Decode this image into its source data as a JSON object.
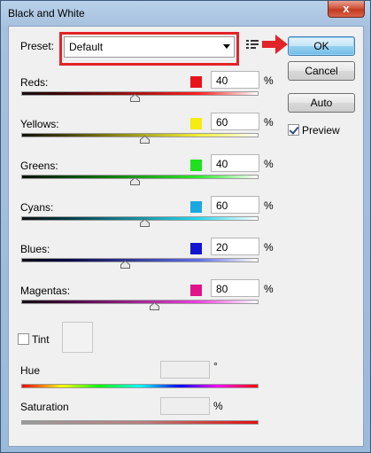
{
  "window": {
    "title": "Black and White",
    "close_glyph": "x"
  },
  "preset": {
    "label": "Preset:",
    "value": "Default"
  },
  "buttons": {
    "ok": "OK",
    "cancel": "Cancel",
    "auto": "Auto"
  },
  "preview": {
    "label": "Preview",
    "checked": true
  },
  "sliders": [
    {
      "name": "reds",
      "label": "Reds:",
      "value": "40",
      "unit": "%",
      "swatch": "#e8141c",
      "track_from": "#3a0000",
      "track_to": "#ff2020",
      "level": 0.48
    },
    {
      "name": "yellows",
      "label": "Yellows:",
      "value": "60",
      "unit": "%",
      "swatch": "#f5ec10",
      "track_from": "#3a3600",
      "track_to": "#f5ef35",
      "level": 0.52
    },
    {
      "name": "greens",
      "label": "Greens:",
      "value": "40",
      "unit": "%",
      "swatch": "#1fe01c",
      "track_from": "#003a00",
      "track_to": "#2fe82c",
      "level": 0.48
    },
    {
      "name": "cyans",
      "label": "Cyans:",
      "value": "60",
      "unit": "%",
      "swatch": "#1aa8e0",
      "track_from": "#00303a",
      "track_to": "#28d8f0",
      "level": 0.52
    },
    {
      "name": "blues",
      "label": "Blues:",
      "value": "20",
      "unit": "%",
      "swatch": "#1114d0",
      "track_from": "#00003a",
      "track_to": "#5f6ee8",
      "level": 0.44
    },
    {
      "name": "magentas",
      "label": "Magentas:",
      "value": "80",
      "unit": "%",
      "swatch": "#e0138a",
      "track_from": "#3a0030",
      "track_to": "#f040e0",
      "level": 0.56
    }
  ],
  "tint": {
    "label": "Tint",
    "checked": false
  },
  "hue": {
    "label": "Hue",
    "unit": "°"
  },
  "saturation": {
    "label": "Saturation",
    "unit": "%"
  }
}
